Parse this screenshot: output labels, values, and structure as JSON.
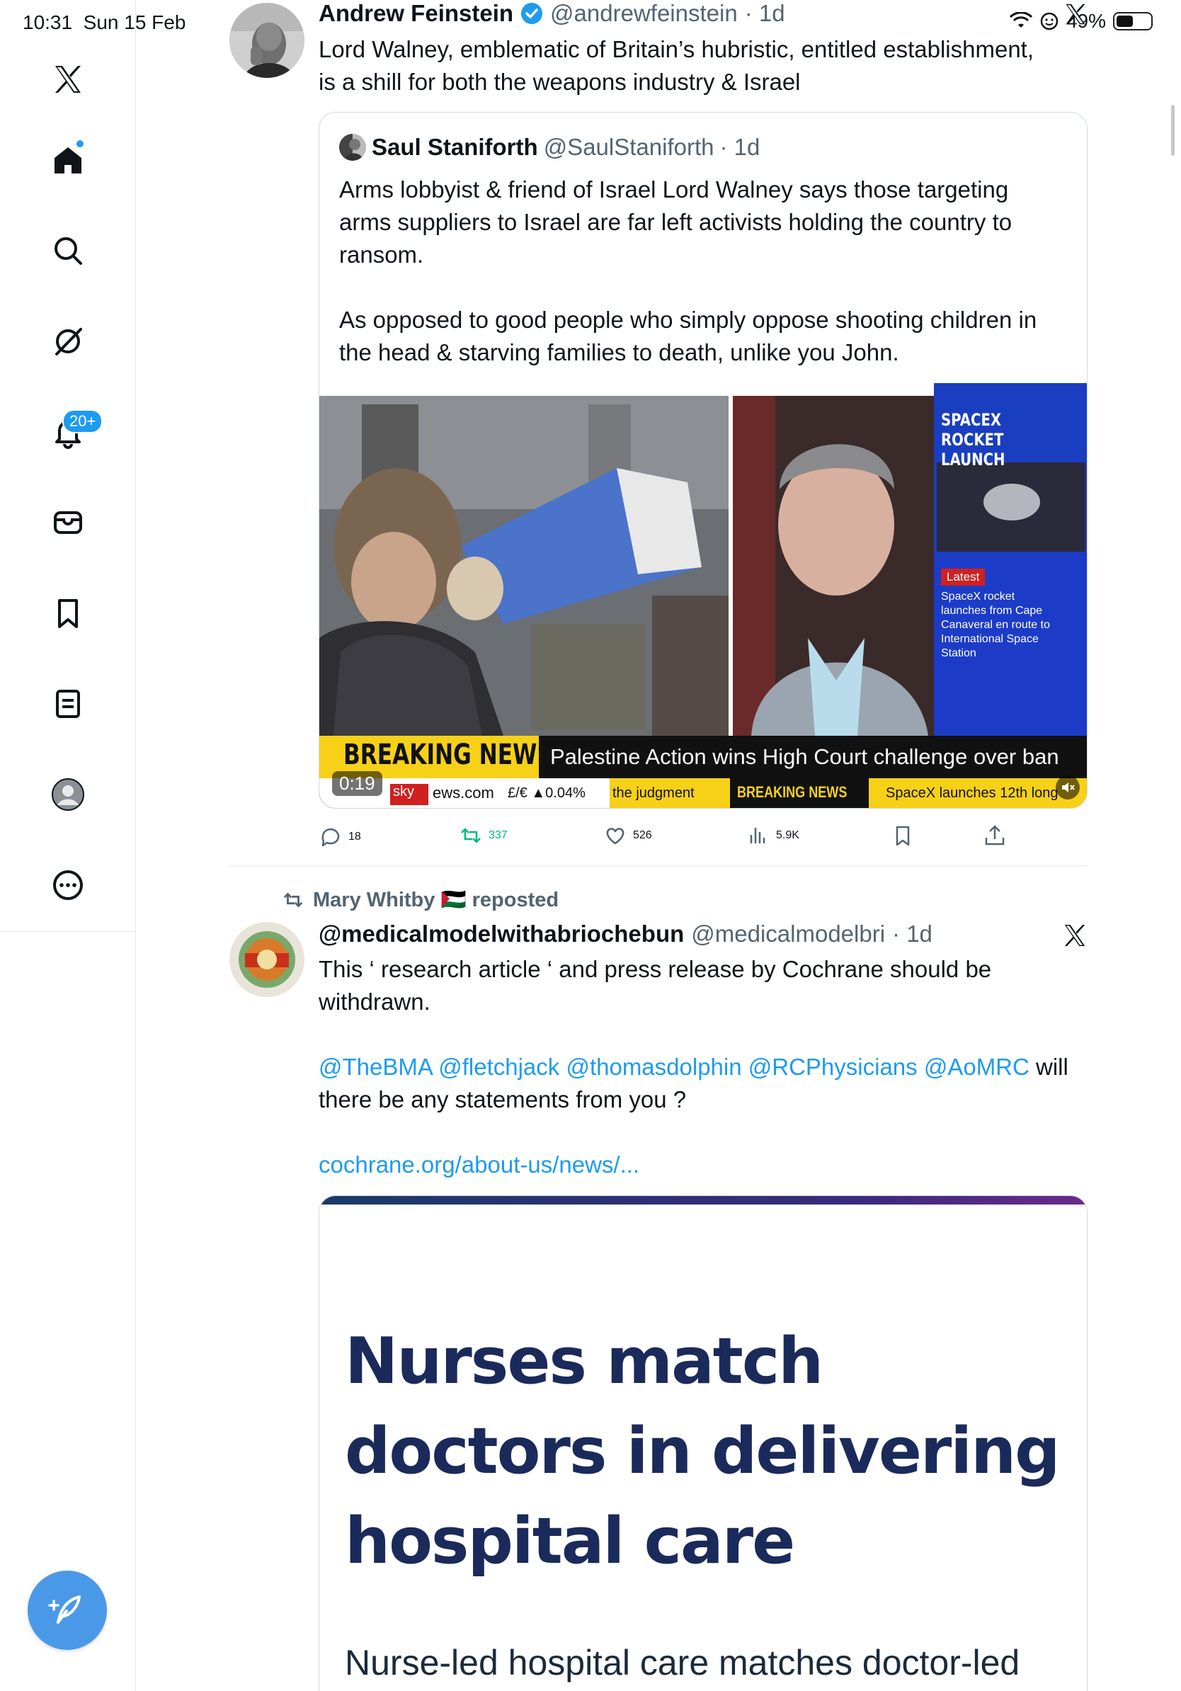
{
  "status_bar": {
    "time": "10:31",
    "date": "Sun 15 Feb",
    "battery_text": "49%",
    "battery_level": 0.49
  },
  "sidebar": {
    "notifications_badge": "20+",
    "items": [
      {
        "name": "x-logo-icon"
      },
      {
        "name": "home-icon"
      },
      {
        "name": "search-icon"
      },
      {
        "name": "grok-icon"
      },
      {
        "name": "notifications-icon"
      },
      {
        "name": "messages-icon"
      },
      {
        "name": "bookmarks-icon"
      },
      {
        "name": "lists-icon"
      },
      {
        "name": "profile-icon"
      },
      {
        "name": "more-icon"
      }
    ]
  },
  "tweet1": {
    "name": "Andrew Feinstein",
    "handle": "@andrewfeinstein",
    "time": "· 1d",
    "text": "Lord Walney, emblematic of Britain’s hubristic, entitled establishment,\nis a shill for both the weapons industry & Israel",
    "quote": {
      "name": "Saul Staniforth",
      "handle": "@SaulStaniforth",
      "time": "· 1d",
      "text": "Arms lobbyist & friend of Israel Lord Walney says those targeting\narms suppliers to Israel are far left activists holding the country to\nransom.\n\nAs opposed to good people who simply oppose shooting children in\nthe head & starving families to death, unlike you John.",
      "video": {
        "side_header": "SPACEX ROCKET\nLAUNCH",
        "latest_label": "Latest",
        "latest_text": "SpaceX rocket\nlaunches from Cape\nCanaveral en route to\nInternational Space\nStation",
        "breaking_label": "BREAKING NEWS",
        "headline": "Palestine Action wins High Court challenge over ban",
        "ticker_site": "ews.com",
        "ticker_sky": "sky",
        "ticker_fx": "£/€ ▲0.04%",
        "ticker_judgment": "the judgment",
        "ticker_breaking": "BREAKING NEWS",
        "ticker_spacex": "SpaceX launches 12th long",
        "duration": "0:19",
        "mute_icon": "mute-icon"
      }
    },
    "actions": {
      "replies": "18",
      "reposts": "337",
      "likes": "526",
      "views": "5.9K"
    }
  },
  "tweet2": {
    "reposted_by": "Mary Whitby 🇵🇸 reposted",
    "name": "@medicalmodelwithabriochebun",
    "handle": "@medicalmodelbri",
    "time": "· 1d",
    "text_line1": "This ‘ research article ‘ and press release by Cochrane should be\nwithdrawn.",
    "mentions": "@TheBMA @fletchjack @thomasdolphin @RCPhysicians @AoMRC",
    "text_line2_a": " will",
    "text_line2_b": "there be any statements from you ?",
    "link": "cochrane.org/about-us/news/...",
    "card": {
      "headline": "Nurses match\ndoctors in delivering\nhospital care",
      "subhead": "Nurse-led hospital care matches doctor-led"
    }
  },
  "colors": {
    "accent": "#1d9bf0",
    "repost_green": "#00ba7c",
    "secondary_text": "#536471",
    "compose_button": "#4a99e9",
    "card_headline": "#1a2a5a",
    "breaking_yellow": "#f7d117",
    "sky_blue": "#1a3ec0"
  }
}
